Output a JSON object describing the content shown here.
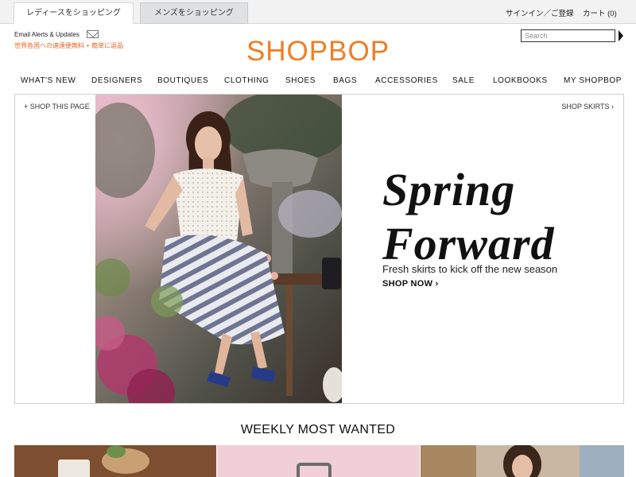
{
  "topbar": {
    "tabs": [
      {
        "label": "レディースをショッピング",
        "active": true
      },
      {
        "label": "メンズをショッピング",
        "active": false
      }
    ],
    "sign_in": "サインイン／ご登録",
    "cart": "カート (0)"
  },
  "header": {
    "email_alerts": "Email Alerts & Updates",
    "promo": "世界各国への速達便無料 + 簡単に返品",
    "logo": "SHOPBOP",
    "search_placeholder": "Search",
    "brand_color": "#f07d24"
  },
  "nav": {
    "items": [
      "WHAT'S NEW",
      "DESIGNERS",
      "BOUTIQUES",
      "CLOTHING",
      "SHOES",
      "BAGS",
      "ACCESSORIES",
      "SALE",
      "LOOKBOOKS",
      "MY SHOPBOP"
    ]
  },
  "hero": {
    "shop_this_page": "+ SHOP THIS PAGE",
    "shop_skirts": "SHOP SKIRTS",
    "headline_line1": "Spring",
    "headline_line2": "Forward",
    "subhead": "Fresh skirts to kick off the new season",
    "cta": "SHOP NOW"
  },
  "weekly": {
    "title": "WEEKLY MOST WANTED"
  }
}
